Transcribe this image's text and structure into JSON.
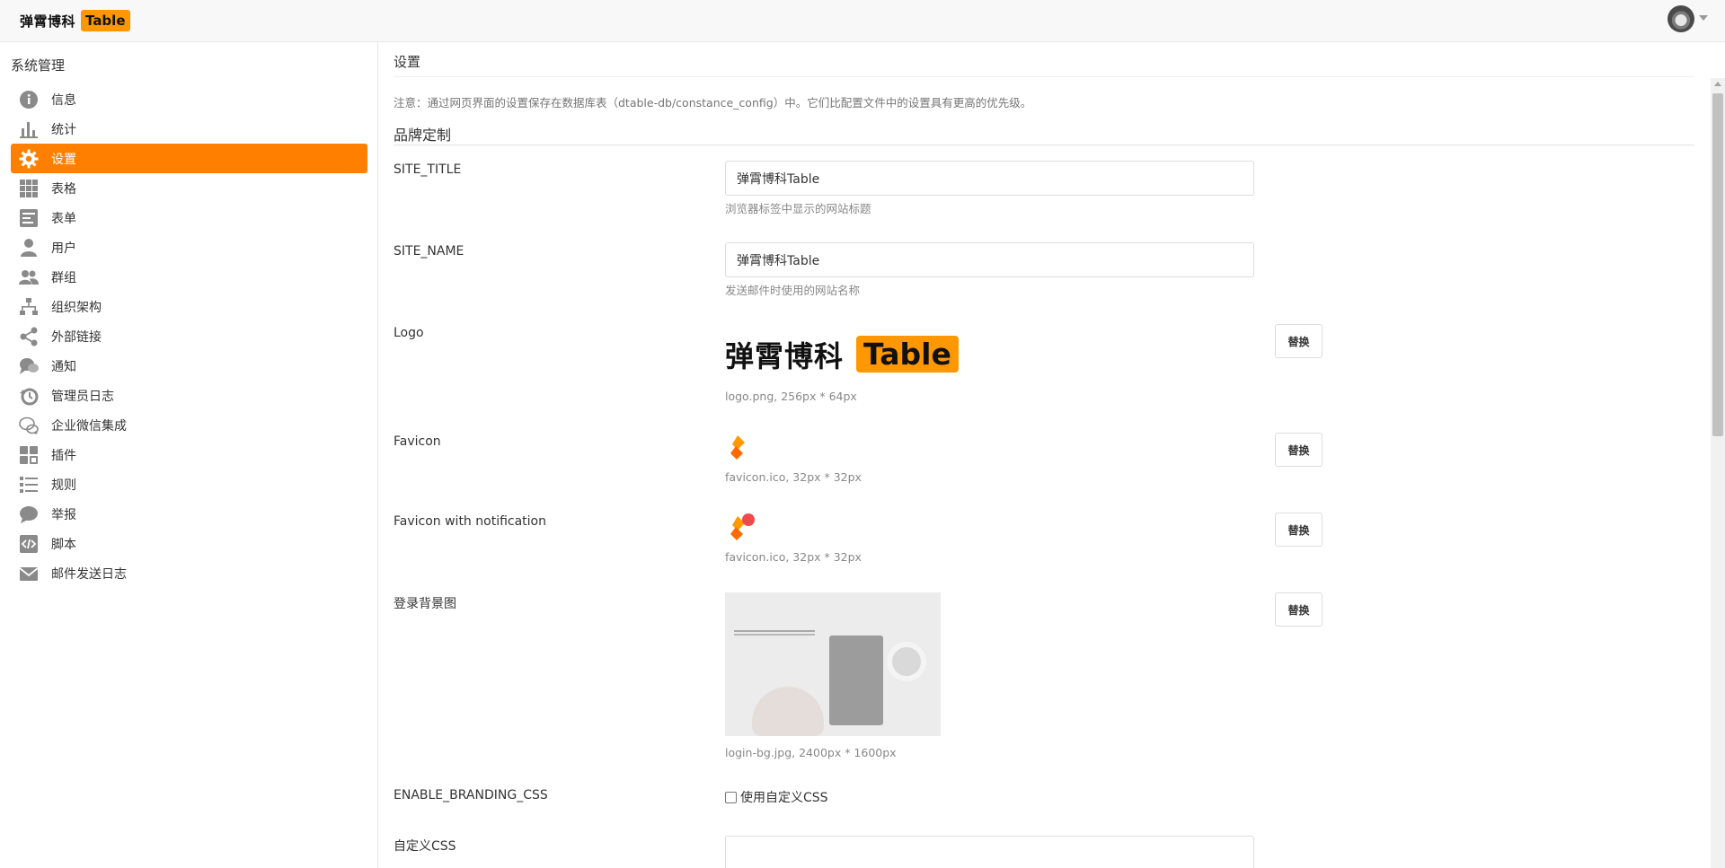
{
  "header": {
    "logo_text": "弹霄博科",
    "logo_badge": "Table",
    "avatar_icon": "user-avatar"
  },
  "sidebar": {
    "title": "系统管理",
    "items": [
      {
        "label": "信息",
        "icon": "info-icon"
      },
      {
        "label": "统计",
        "icon": "bar-chart-icon"
      },
      {
        "label": "设置",
        "icon": "gear-icon",
        "active": true
      },
      {
        "label": "表格",
        "icon": "grid-icon"
      },
      {
        "label": "表单",
        "icon": "form-icon"
      },
      {
        "label": "用户",
        "icon": "user-icon"
      },
      {
        "label": "群组",
        "icon": "group-icon"
      },
      {
        "label": "组织架构",
        "icon": "org-chart-icon"
      },
      {
        "label": "外部链接",
        "icon": "share-icon"
      },
      {
        "label": "通知",
        "icon": "notification-icon"
      },
      {
        "label": "管理员日志",
        "icon": "admin-log-icon"
      },
      {
        "label": "企业微信集成",
        "icon": "wechat-icon"
      },
      {
        "label": "插件",
        "icon": "plugin-icon"
      },
      {
        "label": "规则",
        "icon": "rules-icon"
      },
      {
        "label": "举报",
        "icon": "report-icon"
      },
      {
        "label": "脚本",
        "icon": "script-icon"
      },
      {
        "label": "邮件发送日志",
        "icon": "mail-icon"
      }
    ],
    "accent_color": "#ff8000"
  },
  "main": {
    "title": "设置",
    "notice": "注意：通过网页界面的设置保存在数据库表（dtable-db/constance_config）中。它们比配置文件中的设置具有更高的优先级。",
    "section_title": "品牌定制",
    "site_title": {
      "label": "SITE_TITLE",
      "value": "弹霄博科Table",
      "help": "浏览器标签中显示的网站标题"
    },
    "site_name": {
      "label": "SITE_NAME",
      "value": "弹霄博科Table",
      "help": "发送邮件时使用的网站名称"
    },
    "logo": {
      "label": "Logo",
      "preview_cn": "弹霄博科",
      "preview_en": "Table",
      "help": "logo.png, 256px * 64px",
      "button": "替换"
    },
    "favicon": {
      "label": "Favicon",
      "help": "favicon.ico, 32px * 32px",
      "button": "替换"
    },
    "favicon_notification": {
      "label": "Favicon with notification",
      "help": "favicon.ico, 32px * 32px",
      "button": "替换"
    },
    "login_bg": {
      "label": "登录背景图",
      "help": "login-bg.jpg, 2400px * 1600px",
      "button": "替换"
    },
    "enable_branding_css": {
      "label": "ENABLE_BRANDING_CSS",
      "checkbox_label": "使用自定义CSS",
      "checked": false
    },
    "custom_css": {
      "label": "自定义CSS",
      "value": ""
    }
  }
}
